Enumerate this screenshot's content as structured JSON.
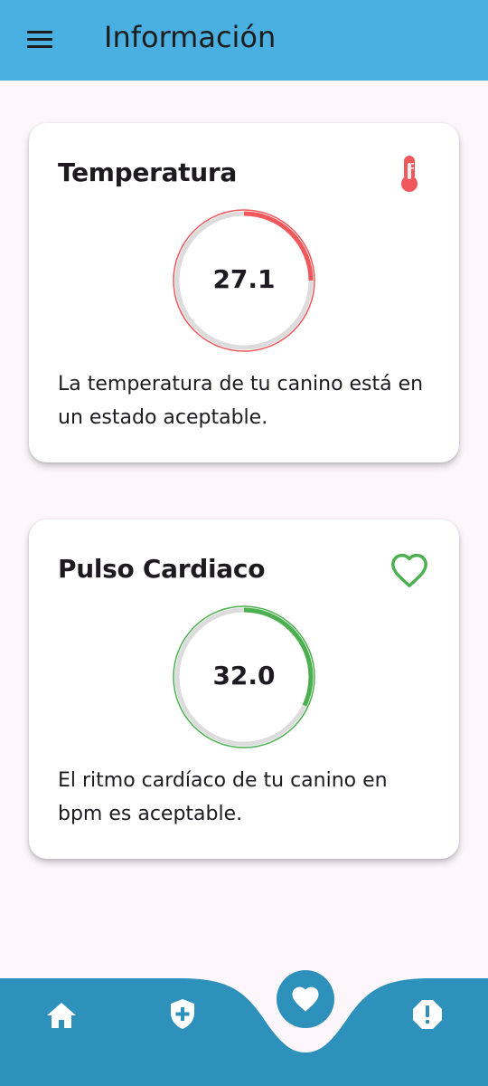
{
  "app_bar": {
    "title": "Información",
    "color": "#4aafe1"
  },
  "cards": [
    {
      "title": "Temperatura",
      "icon": "thermometer-icon",
      "value": "27.1",
      "progress": 0.25,
      "accent": "#f0585c",
      "description": "La temperatura de tu canino está en un estado aceptable."
    },
    {
      "title": "Pulso Cardiaco",
      "icon": "heart-outline-icon",
      "value": "32.0",
      "progress": 0.32,
      "accent": "#4caf50",
      "description": "El ritmo cardíaco de tu canino en bpm es aceptable."
    }
  ],
  "bottom_nav": {
    "color": "#2e91bc",
    "items": [
      {
        "icon": "home-icon"
      },
      {
        "icon": "shield-plus-icon"
      },
      {
        "icon": "heart-icon",
        "selected": true
      },
      {
        "icon": "alert-icon"
      }
    ]
  }
}
